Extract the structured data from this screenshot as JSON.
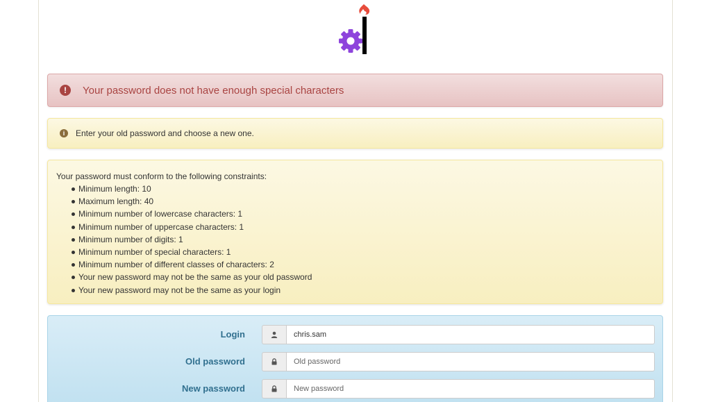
{
  "alert": {
    "icon": "exclamation-circle-icon",
    "message": "Your password does not have enough special characters",
    "color": "#a94442"
  },
  "info": {
    "icon": "info-circle-icon",
    "message": "Enter your old password and choose a new one."
  },
  "constraints": {
    "intro": "Your password must conform to the following constraints:",
    "items": [
      "Minimum length: 10",
      "Maximum length: 40",
      "Minimum number of lowercase characters: 1",
      "Minimum number of uppercase characters: 1",
      "Minimum number of digits: 1",
      "Minimum number of special characters: 1",
      "Minimum number of different classes of characters: 2",
      "Your new password may not be the same as your old password",
      "Your new password may not be the same as your login"
    ]
  },
  "form": {
    "login": {
      "label": "Login",
      "value": "chris.sam",
      "icon": "user-icon"
    },
    "old_password": {
      "label": "Old password",
      "placeholder": "Old password",
      "icon": "lock-icon"
    },
    "new_password": {
      "label": "New password",
      "placeholder": "New password",
      "icon": "lock-icon"
    }
  },
  "colors": {
    "danger": "#a94442",
    "warning_bg": "#fcf8e3",
    "info_bg": "#d9edf7",
    "label": "#31708f",
    "logo_gear": "#8e44dc",
    "logo_flame": "#e74c3c"
  }
}
